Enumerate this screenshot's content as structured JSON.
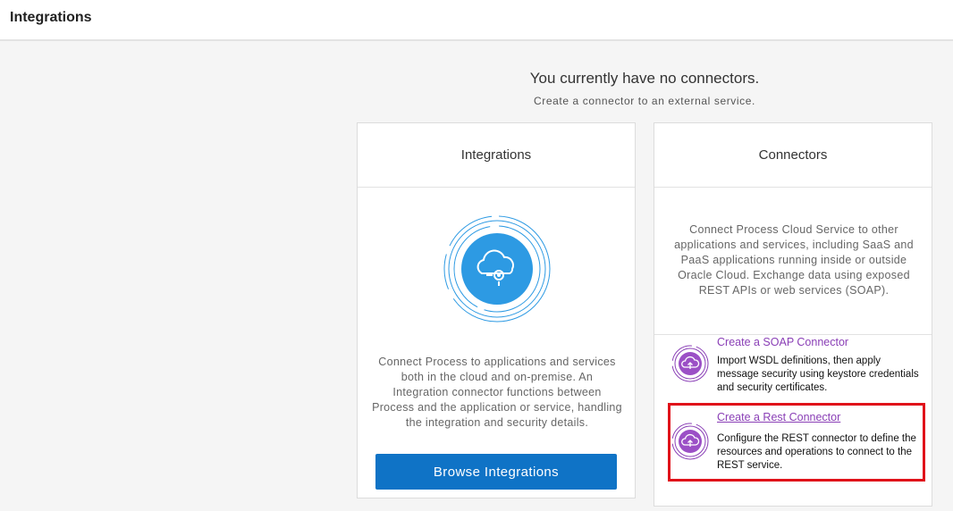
{
  "header": {
    "title": "Integrations"
  },
  "empty_state": {
    "title": "You currently have no connectors.",
    "subtitle": "Create a connector to an external service."
  },
  "integrations_card": {
    "title": "Integrations",
    "icon": "cloud-integration-icon",
    "description": "Connect Process to applications and services both in the cloud and on-premise. An Integration connector functions between Process and the application or service, handling the integration and security details.",
    "button_label": "Browse Integrations"
  },
  "connectors_card": {
    "title": "Connectors",
    "description": "Connect Process Cloud Service to other applications and services, including SaaS and PaaS applications running inside or outside Oracle Cloud. Exchange data using exposed REST APIs or web services (SOAP).",
    "options": [
      {
        "link": "Create a SOAP Connector",
        "text": "Import WSDL definitions, then apply message security using keystore credentials and security certificates.",
        "icon": "cloud-upload-icon"
      },
      {
        "link": "Create a Rest Connector",
        "text": "Configure the REST connector to define the resources and operations to connect to the REST service.",
        "icon": "cloud-upload-icon"
      }
    ]
  },
  "colors": {
    "primary_button": "#0f73c6",
    "link": "#8a3fb6",
    "highlight": "#e0121a",
    "integration_icon": "#2d9ae3"
  }
}
